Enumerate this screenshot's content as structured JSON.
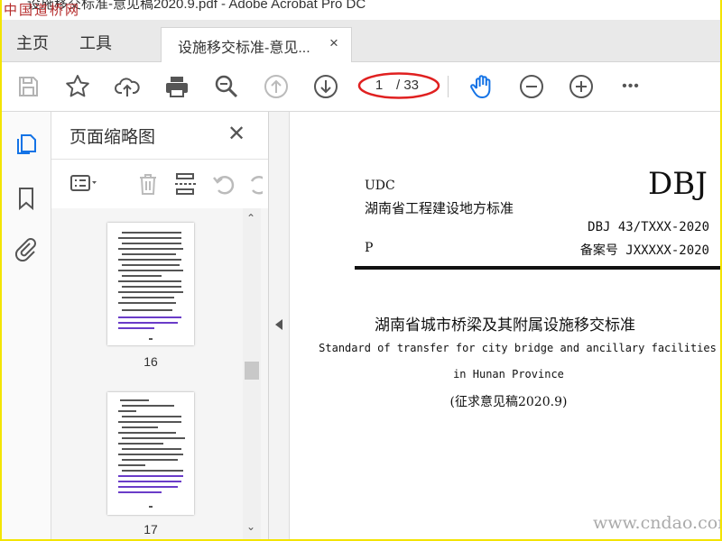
{
  "window": {
    "title": "设施移交标准-意见稿2020.9.pdf - Adobe Acrobat Pro DC",
    "watermark_top": "中国道桥网"
  },
  "tabs": {
    "home": "主页",
    "tools": "工具",
    "document": "设施移交标准-意见...",
    "close": "×"
  },
  "toolbar": {
    "current_page": "1",
    "total_pages": "/ 33",
    "more": "•••"
  },
  "thumbnail_panel": {
    "title": "页面缩略图",
    "close": "✕",
    "thumbnails": [
      {
        "page": "16"
      },
      {
        "page": "17"
      }
    ]
  },
  "document": {
    "udc": "UDC",
    "series": "DBJ",
    "province_standard": "湖南省工程建设地方标准",
    "code": "DBJ 43/TXXX-2020",
    "p_label": "P",
    "record": "备案号 JXXXXX-2020",
    "title_cn": "湖南省城市桥梁及其附属设施移交标准",
    "title_en_1": "Standard of transfer for city bridge and ancillary facilities",
    "title_en_2": "in Hunan Province",
    "draft": "(征求意见稿2020.9)",
    "watermark": "www.cndao.com"
  },
  "colors": {
    "frame": "#f3e400",
    "hand_tool": "#1473e6",
    "annotation_ring": "#e02020",
    "active_icon": "#1473e6"
  }
}
